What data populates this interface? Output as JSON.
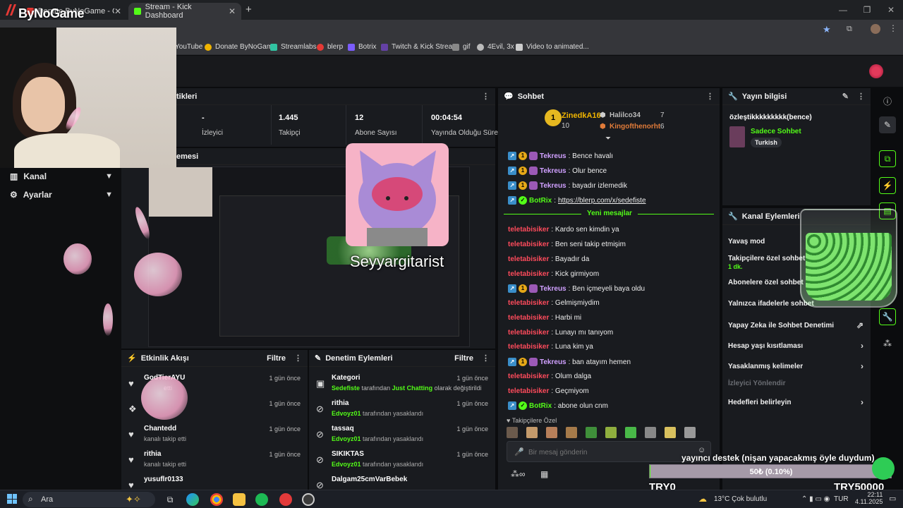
{
  "browser": {
    "tabs": [
      {
        "label": "Donate ByNoGame - Gelen/Gid"
      },
      {
        "label": "Stream - Kick Dashboard"
      }
    ],
    "new_tab": "+",
    "bookmarks": [
      "YouTube",
      "Donate ByNoGame",
      "Streamlabs",
      "blerp",
      "Botrix",
      "Twitch & Kick Strea...",
      "gif",
      "4Evil, 3x",
      "Video to animated..."
    ]
  },
  "overlay_logo": "ByNoGame",
  "sidebar": {
    "items": [
      {
        "label": "Kanal"
      },
      {
        "label": "Ayarlar"
      }
    ]
  },
  "stats": {
    "header": "tikleri",
    "items": [
      {
        "value": "-",
        "label": "İzleyici"
      },
      {
        "value": "1.445",
        "label": "Takipçi"
      },
      {
        "value": "12",
        "label": "Abone Sayısı"
      },
      {
        "value": "00:04:54",
        "label": "Yayında Olduğu Süre"
      }
    ]
  },
  "preview": {
    "header": "emesi"
  },
  "overlay_name": "Seyyargitarist",
  "activity": {
    "title": "Etkinlik Akışı",
    "filter": "Filtre",
    "rows": [
      {
        "name": "GodTierAYU",
        "sub": "etti",
        "time": "1 gün önce"
      },
      {
        "name": "",
        "sub": "",
        "time": "1 gün önce"
      },
      {
        "name": "Chantedd",
        "sub": "kanalı takip etti",
        "time": "1 gün önce"
      },
      {
        "name": "rithia",
        "sub": "kanalı takip etti",
        "time": "1 gün önce"
      },
      {
        "name": "yusuflr0133",
        "sub": "",
        "time": "1 gün önce"
      }
    ]
  },
  "moderation": {
    "title": "Denetim Eylemleri",
    "filter": "Filtre",
    "rows": [
      {
        "name": "Kategori",
        "actor": "Sedefiste",
        "mid": "tarafından",
        "target": "Just Chatting",
        "rest": "olarak değiştirildi",
        "time": "1 gün önce"
      },
      {
        "name": "rithia",
        "actor": "Edvoyz01",
        "mid": "tarafından yasaklandı",
        "time": "1 gün önce"
      },
      {
        "name": "tassaq",
        "actor": "Edvoyz01",
        "mid": "tarafından yasaklandı",
        "time": "1 gün önce"
      },
      {
        "name": "SIKIKTAS",
        "actor": "Edvoyz01",
        "mid": "tarafından yasaklandı",
        "time": "1 gün önce"
      },
      {
        "name": "Dalgam25cmVarBebek",
        "actor": "",
        "mid": "",
        "time": ""
      }
    ]
  },
  "chat": {
    "title": "Sohbet",
    "leaderboard": {
      "first": {
        "rank": "1",
        "name": "ZinedkA16",
        "count": "10"
      },
      "second": {
        "name": "Halilco34",
        "count": "7"
      },
      "third": {
        "name": "Kingofthenorht",
        "count": "6"
      }
    },
    "messages": [
      {
        "user": "Tekreus",
        "text": ": Bence havalı",
        "color": "#d0a0ff",
        "badges": true
      },
      {
        "user": "Tekreus",
        "text": ": Olur bence",
        "color": "#d0a0ff",
        "badges": true
      },
      {
        "user": "Tekreus",
        "text": ": bayadır izlemedik",
        "color": "#d0a0ff",
        "badges": true
      },
      {
        "user": "BotRix",
        "text": "https://blerp.com/x/sedefiste",
        "color": "#53fc18",
        "badges": true,
        "link": true
      }
    ],
    "divider": "Yeni mesajlar",
    "new_messages": [
      {
        "user": "teletabisiker",
        "text": ": Kardo sen kimdin ya",
        "color": "#ff4b5c"
      },
      {
        "user": "teletabisiker",
        "text": ": Ben seni takip etmişim",
        "color": "#ff4b5c"
      },
      {
        "user": "teletabisiker",
        "text": ": Bayadır da",
        "color": "#ff4b5c"
      },
      {
        "user": "teletabisiker",
        "text": ": Kick girmiyom",
        "color": "#ff4b5c"
      },
      {
        "user": "Tekreus",
        "text": ": Ben içmeyeli baya oldu",
        "color": "#d0a0ff",
        "badges": true
      },
      {
        "user": "teletabisiker",
        "text": ": Gelmişmiydim",
        "color": "#ff4b5c"
      },
      {
        "user": "teletabisiker",
        "text": ": Harbi mi",
        "color": "#ff4b5c"
      },
      {
        "user": "teletabisiker",
        "text": ": Lunayı mı tanıyom",
        "color": "#ff4b5c"
      },
      {
        "user": "teletabisiker",
        "text": ": Luna kim ya",
        "color": "#ff4b5c"
      },
      {
        "user": "Tekreus",
        "text": ": ban atayım hemen",
        "color": "#d0a0ff",
        "badges": true
      },
      {
        "user": "teletabisiker",
        "text": ": Olum dalga",
        "color": "#ff4b5c"
      },
      {
        "user": "teletabisiker",
        "text": ": Geçmiyom",
        "color": "#ff4b5c"
      },
      {
        "user": "BotRix",
        "text": ": abone olun cnm",
        "color": "#53fc18",
        "badges": true
      }
    ],
    "followers_only": "Takipçilere Özel",
    "input_placeholder": "Bir mesaj gönderin"
  },
  "stream_info": {
    "title": "Yayın bilgisi",
    "stream_title": "özleştikkkkkkkkk(bence)",
    "category": "Sadece Sohbet",
    "language": "Turkish"
  },
  "channel_actions": {
    "title": "Kanal Eylemleri",
    "items": [
      {
        "label": "Yavaş mod"
      },
      {
        "label": "Takipçilere özel sohbet",
        "sub": "1 dk."
      },
      {
        "label": "Abonelere özel sohbet"
      },
      {
        "label": "Yalnızca ifadelerle sohbet"
      },
      {
        "label": "Yapay Zeka ile Sohbet Denetimi"
      },
      {
        "label": "Hesap yaşı kısıtlaması"
      },
      {
        "label": "Yasaklanmış kelimeler"
      },
      {
        "label": "İzleyici Yönlendir"
      },
      {
        "label": "Hedefleri belirleyin"
      }
    ]
  },
  "donation_goal": {
    "title": "yayıncı destek (nişan yapacakmış öyle duydum)",
    "progress_text": "50₺ (0.10%)",
    "progress": 0.1,
    "min": "TRY0",
    "max": "TRY50000"
  },
  "taskbar": {
    "search": "Ara",
    "weather": "13°C  Çok bulutlu",
    "lang": "TUR",
    "time": "22:11",
    "date": "4.11.2025"
  },
  "colors": {
    "accent": "#53fc18",
    "bg": "#0b0c0e",
    "panel": "#191b1f"
  }
}
